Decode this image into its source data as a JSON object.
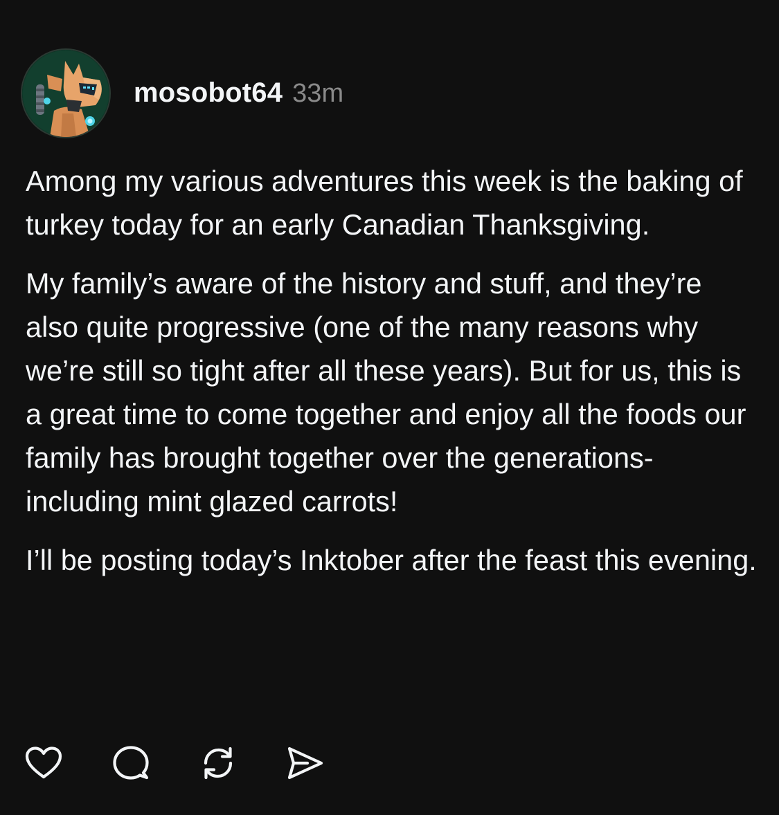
{
  "post": {
    "username": "mosobot64",
    "timestamp": "33m",
    "paragraphs": [
      "Among my various adventures this week is the baking of turkey today for an early Canadian Thanksgiving.",
      "My family’s aware of the history and stuff, and they’re also quite progressive (one of the many reasons why we’re still so tight after all these years). But for us, this is a great time to come together and enjoy all the foods our family has brought together over the generations-including mint glazed carrots!",
      "I’ll be posting today’s Inktober after the feast this evening."
    ]
  },
  "actions": [
    {
      "name": "like",
      "icon": "heart-icon"
    },
    {
      "name": "comment",
      "icon": "comment-bubble-icon"
    },
    {
      "name": "repost",
      "icon": "repost-icon"
    },
    {
      "name": "share",
      "icon": "send-icon"
    }
  ],
  "colors": {
    "background": "#101010",
    "text": "#f3f5f7",
    "muted": "#8a8a8a",
    "icon": "#f3f5f7"
  }
}
